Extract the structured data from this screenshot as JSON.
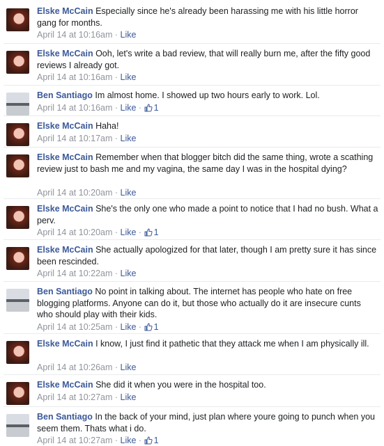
{
  "comments": [
    {
      "author": "Elske McCain",
      "avatar": "elske-avatar",
      "text": "Especially since he's already been harassing me with his little horror gang for months.",
      "time": "April 14 at 10:16am",
      "like_label": "Like",
      "likes": null
    },
    {
      "author": "Elske McCain",
      "avatar": "elske-avatar",
      "text": "Ooh, let's write a bad review, that will really burn me, after the fifty good reviews I already got.",
      "time": "April 14 at 10:16am",
      "like_label": "Like",
      "likes": null
    },
    {
      "author": "Ben Santiago",
      "avatar": "ben-avatar",
      "text": "Im almost home. I showed up two hours early to work. Lol.",
      "time": "April 14 at 10:16am",
      "like_label": "Like",
      "likes": "1"
    },
    {
      "author": "Elske McCain",
      "avatar": "elske-avatar",
      "text": "Haha!",
      "time": "April 14 at 10:17am",
      "like_label": "Like",
      "likes": null
    },
    {
      "author": "Elske McCain",
      "avatar": "elske-avatar",
      "text": "Remember when that blogger bitch did the same thing, wrote a scathing review just to bash me and my vagina, the same day I was in the hospital dying?",
      "time": "April 14 at 10:20am",
      "like_label": "Like",
      "likes": null
    },
    {
      "author": "Elske McCain",
      "avatar": "elske-avatar",
      "text": "She's the only one who made a point to notice that I had no bush. What a perv.",
      "time": "April 14 at 10:20am",
      "like_label": "Like",
      "likes": "1"
    },
    {
      "author": "Elske McCain",
      "avatar": "elske-avatar",
      "text": "She actually apologized for that later, though I am pretty sure it has since been rescinded.",
      "time": "April 14 at 10:22am",
      "like_label": "Like",
      "likes": null
    },
    {
      "author": "Ben Santiago",
      "avatar": "ben-avatar",
      "text": "No point in talking about. The internet has people who hate on free blogging platforms. Anyone can do it, but those who actually do it are insecure cunts who should play with their kids.",
      "time": "April 14 at 10:25am",
      "like_label": "Like",
      "likes": "1"
    },
    {
      "author": "Elske McCain",
      "avatar": "elske-avatar",
      "text": "I know, I just find it pathetic that they attack me when I am physically ill.",
      "time": "April 14 at 10:26am",
      "like_label": "Like",
      "likes": null
    },
    {
      "author": "Elske McCain",
      "avatar": "elske-avatar",
      "text": "She did it when you were in the hospital too.",
      "time": "April 14 at 10:27am",
      "like_label": "Like",
      "likes": null
    },
    {
      "author": "Ben Santiago",
      "avatar": "ben-avatar",
      "text": "In the back of your mind, just plan where youre going to punch when you seem them. Thats what i do.",
      "time": "April 14 at 10:27am",
      "like_label": "Like",
      "likes": "1"
    }
  ],
  "separator": " · ",
  "colors": {
    "link": "#3b5998",
    "meta": "#90949c",
    "text": "#1c1e21"
  }
}
